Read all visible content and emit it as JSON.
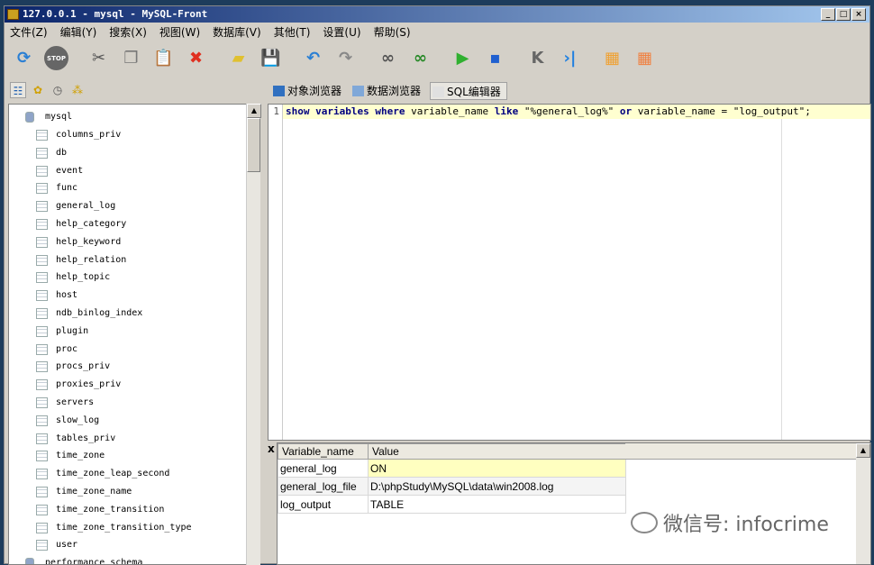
{
  "window": {
    "title": "127.0.0.1 - mysql - MySQL-Front"
  },
  "menu": [
    "文件(Z)",
    "编辑(Y)",
    "搜索(X)",
    "视图(W)",
    "数据库(V)",
    "其他(T)",
    "设置(U)",
    "帮助(S)"
  ],
  "toolbar": [
    {
      "icon": "refresh-icon",
      "glyph": "⟳",
      "color": "#2a7fd4"
    },
    {
      "icon": "stop-icon",
      "glyph": "STOP",
      "color": "#666"
    },
    {
      "icon": "cut-icon",
      "glyph": "✂",
      "color": "#555"
    },
    {
      "icon": "copy-icon",
      "glyph": "❐",
      "color": "#777"
    },
    {
      "icon": "paste-icon",
      "glyph": "📋",
      "color": "#777"
    },
    {
      "icon": "delete-icon",
      "glyph": "✖",
      "color": "#e03020"
    },
    {
      "icon": "open-icon",
      "glyph": "▰",
      "color": "#e0c030"
    },
    {
      "icon": "save-icon",
      "glyph": "💾",
      "color": "#2050b0"
    },
    {
      "icon": "undo-icon",
      "glyph": "↶",
      "color": "#2a7fd4"
    },
    {
      "icon": "redo-icon",
      "glyph": "↷",
      "color": "#888"
    },
    {
      "icon": "find-icon",
      "glyph": "∞",
      "color": "#555"
    },
    {
      "icon": "replace-icon",
      "glyph": "∞",
      "color": "#2a8a2a"
    },
    {
      "icon": "run-icon",
      "glyph": "▶",
      "color": "#30b030"
    },
    {
      "icon": "run-selection-icon",
      "glyph": "▪",
      "color": "#2060d0"
    },
    {
      "icon": "first-icon",
      "glyph": "K",
      "color": "#666"
    },
    {
      "icon": "last-icon",
      "glyph": "›|",
      "color": "#2080e0"
    },
    {
      "icon": "insert-row-icon",
      "glyph": "▦",
      "color": "#f0a030"
    },
    {
      "icon": "delete-row-icon",
      "glyph": "▦",
      "color": "#f08040"
    }
  ],
  "tabs": [
    {
      "label": "对象浏览器",
      "icon": "object-browser-icon"
    },
    {
      "label": "数据浏览器",
      "icon": "data-browser-icon"
    },
    {
      "label": "SQL编辑器",
      "icon": "sql-editor-icon",
      "active": true
    }
  ],
  "tree": {
    "database": "mysql",
    "tables": [
      "columns_priv",
      "db",
      "event",
      "func",
      "general_log",
      "help_category",
      "help_keyword",
      "help_relation",
      "help_topic",
      "host",
      "ndb_binlog_index",
      "plugin",
      "proc",
      "procs_priv",
      "proxies_priv",
      "servers",
      "slow_log",
      "tables_priv",
      "time_zone",
      "time_zone_leap_second",
      "time_zone_name",
      "time_zone_transition",
      "time_zone_transition_type",
      "user"
    ],
    "next_database": "performance_schema"
  },
  "editor": {
    "line_number": "1",
    "sql": {
      "k1": "show variables where",
      "t1": " variable_name ",
      "k2": "like",
      "s1": " \"%general_log%\" ",
      "k3": "or",
      "t2": " variable_name = ",
      "s2": "\"log_output\";"
    }
  },
  "results": {
    "columns": [
      "Variable_name",
      "Value"
    ],
    "rows": [
      [
        "general_log",
        "ON"
      ],
      [
        "general_log_file",
        "D:\\phpStudy\\MySQL\\data\\win2008.log"
      ],
      [
        "log_output",
        "TABLE"
      ]
    ],
    "close": "x"
  },
  "watermark": "微信号: infocrime"
}
